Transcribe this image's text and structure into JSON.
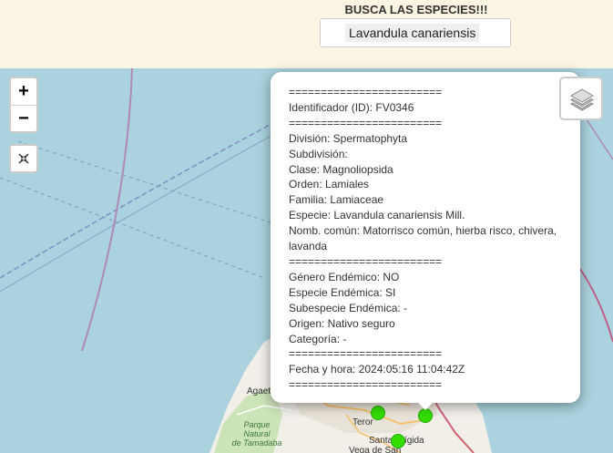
{
  "header": {
    "title": "BUSCA LAS ESPECIES!!!",
    "search_value": "Lavandula canariensis"
  },
  "map_controls": {
    "zoom_in": "+",
    "zoom_out": "−",
    "fullscreen_icon": "fullscreen-icon",
    "layers_icon": "layers-icon"
  },
  "map_labels": {
    "agaete": "Agaete",
    "teror": "Teror",
    "santa_brigida": "Santa Brígida",
    "vega": "Vega de San",
    "park_line1": "Parque",
    "park_line2": "Natural",
    "park_line3": "de Tamadaba"
  },
  "popup": {
    "lines": [
      "========================",
      "Identificador (ID): FV0346",
      "========================",
      "División: Spermatophyta",
      "Subdivisión:",
      "Clase: Magnoliopsida",
      "Orden: Lamiales",
      "Familia: Lamiaceae",
      "Especie: Lavandula canariensis Mill.",
      "Nomb. común: Matorrisco común, hierba risco, chivera, lavanda",
      "========================",
      "Género Endémico: NO",
      "Especie Endémica: SI",
      "Subespecie Endémica: -",
      "Origen: Nativo seguro",
      "Categoría: -",
      "========================",
      "Fecha y hora: 2024:05:16 11:04:42Z",
      "========================"
    ]
  },
  "colors": {
    "sea": "#aad3df",
    "land": "#f2efe9",
    "marker": "#33dd00",
    "header_bg": "#fdf5e3"
  }
}
